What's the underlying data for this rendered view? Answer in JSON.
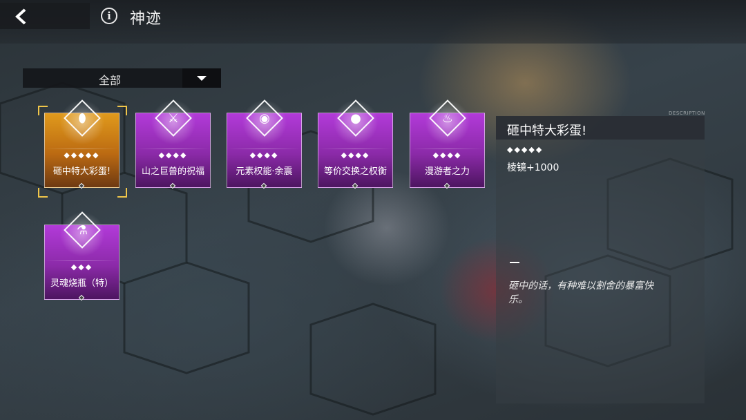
{
  "header": {
    "title": "神迹",
    "back_icon": "chevron-left-icon",
    "info_icon": "info-icon"
  },
  "filter": {
    "selected": "全部"
  },
  "cards": [
    {
      "name": "砸中特大彩蛋!",
      "stars": "◆◆◆◆◆",
      "rank": 5,
      "color": "#e09a1c",
      "icon": "egg-icon",
      "selected": true
    },
    {
      "name": "山之巨兽的祝福",
      "stars": "◆◆◆◆",
      "rank": 4,
      "color": "#b23ad9",
      "icon": "swords-icon",
      "selected": false
    },
    {
      "name": "元素权能·余震",
      "stars": "◆◆◆◆",
      "rank": 4,
      "color": "#b23ad9",
      "icon": "element-icon",
      "selected": false
    },
    {
      "name": "等价交换之权衡",
      "stars": "◆◆◆◆",
      "rank": 4,
      "color": "#b23ad9",
      "icon": "coin-icon",
      "selected": false
    },
    {
      "name": "漫游者之力",
      "stars": "◆◆◆◆",
      "rank": 4,
      "color": "#b23ad9",
      "icon": "flame-icon",
      "selected": false
    },
    {
      "name": "灵魂烧瓶（特）",
      "stars": "◆◆◆",
      "rank": 3,
      "color": "#b23ad9",
      "icon": "flask-icon",
      "selected": false
    }
  ],
  "detail": {
    "tag": "DESCRIPTION",
    "name": "砸中特大彩蛋!",
    "stars": "◆◆◆◆◆",
    "effect": "棱镜+1000",
    "flavor": "砸中的话，有种难以割舍的暴富快乐。"
  }
}
